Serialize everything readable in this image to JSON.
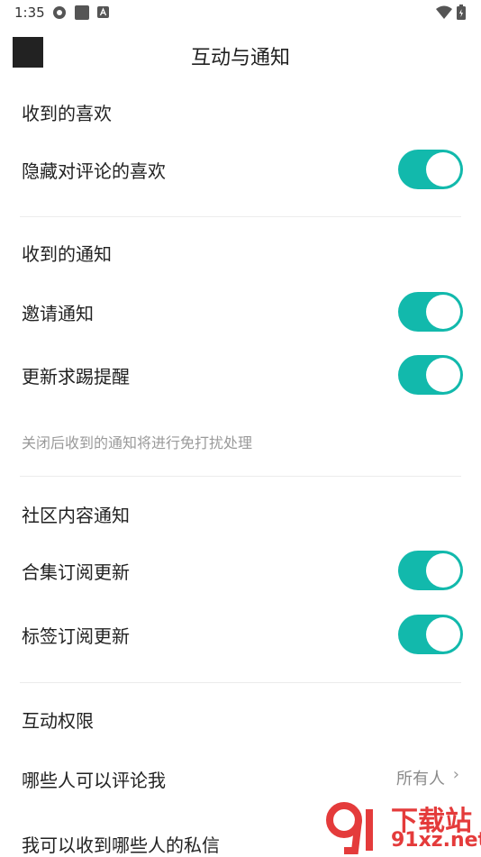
{
  "status_bar": {
    "time": "1:35"
  },
  "header": {
    "title": "互动与通知"
  },
  "sections": {
    "likes": {
      "title": "收到的喜欢",
      "items": [
        {
          "label": "隐藏对评论的喜欢",
          "enabled": true
        }
      ]
    },
    "notifications": {
      "title": "收到的通知",
      "items": [
        {
          "label": "邀请通知",
          "enabled": true
        },
        {
          "label": "更新求踢提醒",
          "enabled": true
        }
      ],
      "note": "关闭后收到的通知将进行免打扰处理"
    },
    "community": {
      "title": "社区内容通知",
      "items": [
        {
          "label": "合集订阅更新",
          "enabled": true
        },
        {
          "label": "标签订阅更新",
          "enabled": true
        }
      ]
    },
    "permissions": {
      "title": "互动权限",
      "items": [
        {
          "label": "哪些人可以评论我",
          "value": "所有人"
        },
        {
          "label": "我可以收到哪些人的私信"
        }
      ]
    }
  },
  "watermark": {
    "line1": "下载站",
    "line2": "91xz.net"
  },
  "colors": {
    "toggle_on": "#12b9ac",
    "divider": "#ececec"
  }
}
